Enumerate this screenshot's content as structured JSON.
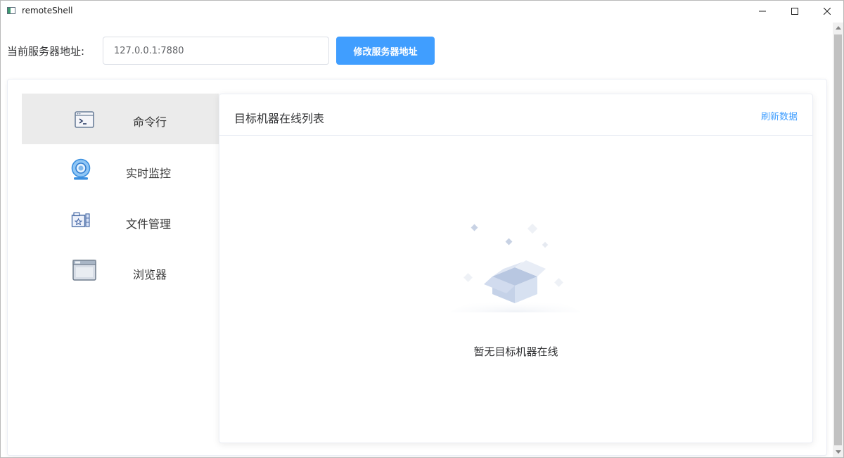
{
  "window": {
    "title": "remoteShell",
    "controls": [
      "minimize-icon",
      "maximize-icon",
      "close-icon"
    ]
  },
  "server": {
    "label": "当前服务器地址:",
    "address": "127.0.0.1:7880",
    "change_button": "修改服务器地址"
  },
  "sidebar": {
    "items": [
      {
        "label": "命令行",
        "icon": "terminal-icon",
        "active": true
      },
      {
        "label": "实时监控",
        "icon": "webcam-icon",
        "active": false
      },
      {
        "label": "文件管理",
        "icon": "file-folder-icon",
        "active": false
      },
      {
        "label": "浏览器",
        "icon": "browser-window-icon",
        "active": false
      }
    ]
  },
  "panel": {
    "title": "目标机器在线列表",
    "refresh_link": "刷新数据",
    "empty_text": "暂无目标机器在线",
    "empty_icon": "empty-box-icon"
  },
  "colors": {
    "accent": "#409eff",
    "active_nav_bg": "#ebebeb",
    "text": "#303133"
  }
}
